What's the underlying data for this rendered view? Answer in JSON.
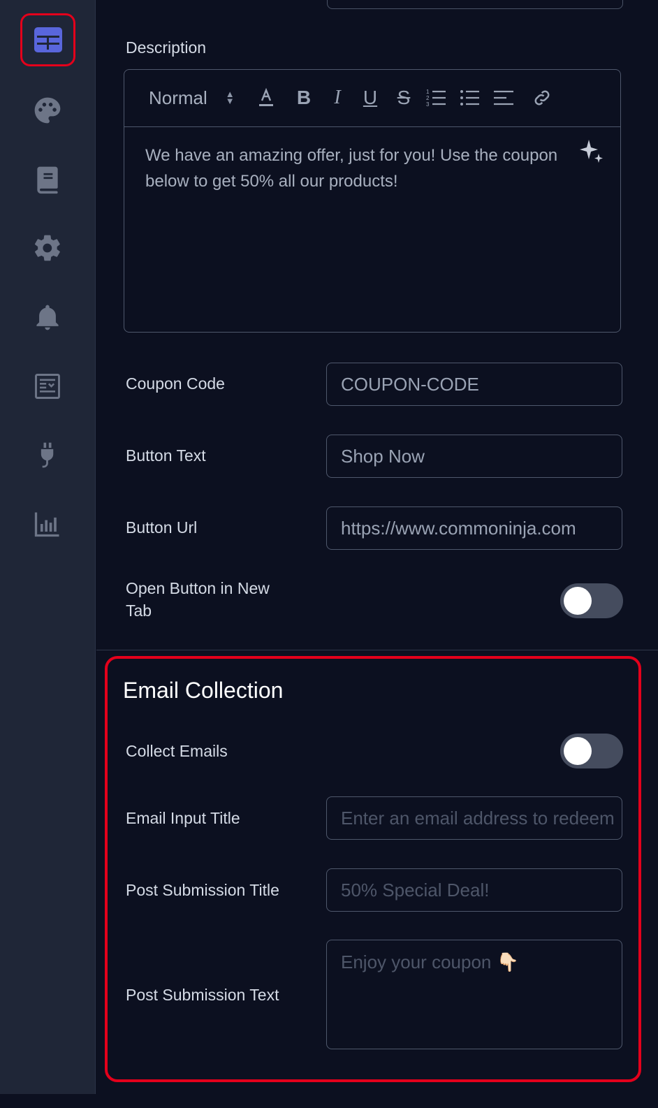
{
  "sidebar": {
    "items": [
      {
        "name": "layout-icon",
        "active": true
      },
      {
        "name": "palette-icon"
      },
      {
        "name": "book-icon"
      },
      {
        "name": "gear-icon"
      },
      {
        "name": "bell-icon"
      },
      {
        "name": "newspaper-icon"
      },
      {
        "name": "plug-icon"
      },
      {
        "name": "chart-bar-icon"
      }
    ],
    "colors": {
      "bg": "#1f2637",
      "icon": "#6d7587",
      "active": "#5966dc",
      "highlight": "#e3001b"
    }
  },
  "description": {
    "label": "Description",
    "format_select": "Normal",
    "text": "We have an amazing offer, just for you! Use the coupon below to get 50% all our products!"
  },
  "coupon": {
    "label": "Coupon Code",
    "value": "COUPON-CODE"
  },
  "button_text": {
    "label": "Button Text",
    "value": "Shop Now"
  },
  "button_url": {
    "label": "Button Url",
    "value": "https://www.commoninja.com"
  },
  "open_new_tab": {
    "label_line1": "Open Button in New",
    "label_line2": "Tab",
    "enabled": false
  },
  "email_collection": {
    "title": "Email Collection",
    "collect_emails": {
      "label": "Collect Emails",
      "enabled": false
    },
    "email_input_title": {
      "label": "Email Input Title",
      "placeholder": "Enter an email address to redeem"
    },
    "post_submission_title": {
      "label": "Post Submission Title",
      "placeholder": "50% Special Deal!"
    },
    "post_submission_text": {
      "label": "Post Submission Text",
      "placeholder": "Enjoy your coupon 👇🏻"
    }
  }
}
